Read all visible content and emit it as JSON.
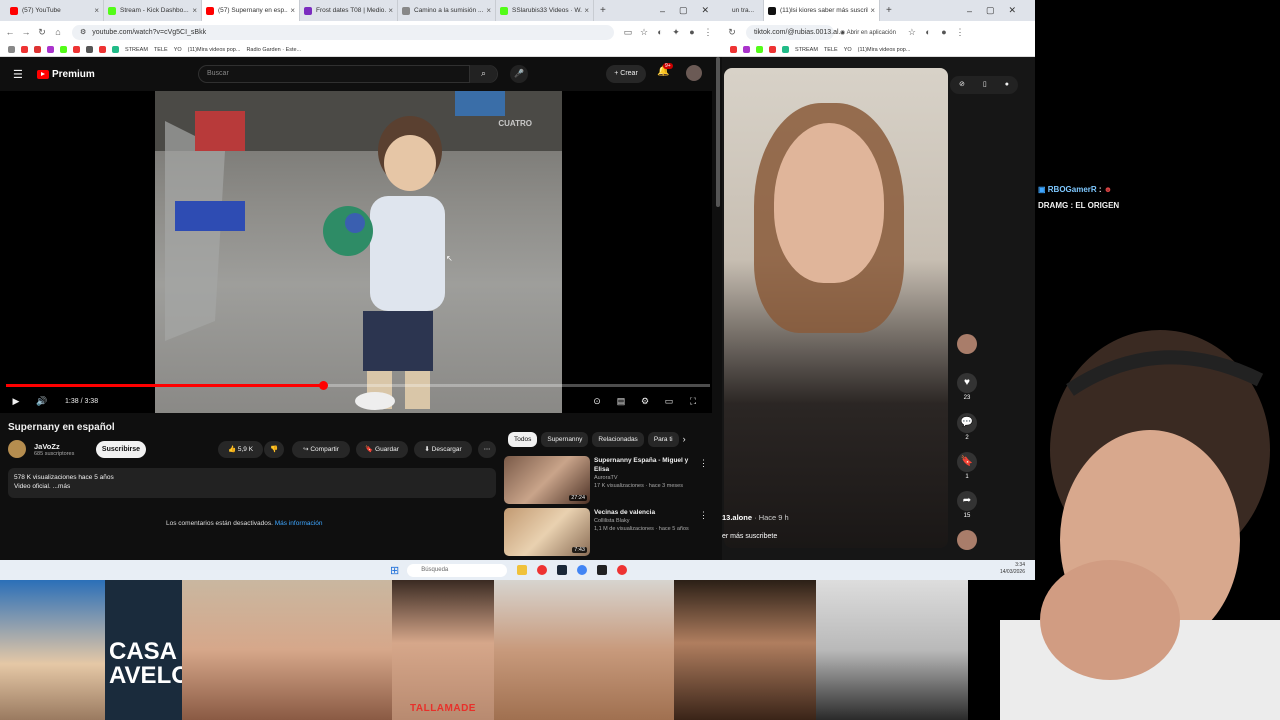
{
  "left_browser": {
    "tabs": [
      {
        "label": "(57) YouTube",
        "color": "#ff0000",
        "active": false
      },
      {
        "label": "Stream - Kick Dashbo...",
        "color": "#53fc18",
        "active": false
      },
      {
        "label": "(57) Supernany en esp...",
        "color": "#ff0000",
        "active": true
      },
      {
        "label": "Frost dates T08 | Medio...",
        "color": "#7b2cbf",
        "active": false
      },
      {
        "label": "Camino a la sumisión ...",
        "color": "#888888",
        "active": false
      },
      {
        "label": "SSlarubis33 Videos · W...",
        "color": "#53fc18",
        "active": false
      }
    ],
    "new_tab": "+",
    "url": "youtube.com/watch?v=cVg5CI_sBkk",
    "bookmarks": [
      "STREAM",
      "TELE",
      "YO",
      "(11)Mira videos pop...",
      "Radio Garden · Este..."
    ]
  },
  "youtube": {
    "logo": "Premium",
    "search_placeholder": "Buscar",
    "create_label": "Crear",
    "notif_badge": "9+",
    "video": {
      "watermark": "CUATRO",
      "time": "1:38 / 3:38",
      "progress": 0.45,
      "title": "Supernany en español",
      "channel": "JaVoZz",
      "subscribers": "685 suscriptores",
      "subscribe_label": "Suscribirse",
      "likes": "5,9 K",
      "share_label": "Compartir",
      "save_label": "Guardar",
      "download_label": "Descargar",
      "views_line": "578 K visualizaciones  hace 5 años",
      "desc_line": "Video oficial. ...más",
      "comments_off": "Los comentarios están desactivados.",
      "more_info": "Más información"
    },
    "chips": [
      "Todos",
      "Supernanny",
      "Relacionadas",
      "Para ti"
    ],
    "recommendations": [
      {
        "title": "Supernanny España - Miguel y Elisa",
        "channel": "AuroraTV",
        "stats": "17 K visualizaciones · hace 3 meses",
        "duration": "27:24"
      },
      {
        "title": "Vecinas de valencia",
        "channel": "Collilista Blaky",
        "stats": "1,1 M de visualizaciones · hace 5 años",
        "duration": "7:43"
      }
    ]
  },
  "right_browser": {
    "tabs": [
      {
        "label": "un tra...",
        "color": "#888888",
        "active": false
      },
      {
        "label": "(11)lsi kiores saber más suscribe",
        "color": "#111111",
        "active": true
      }
    ],
    "url": "tiktok.com/@rubias.0013.al...",
    "open_app": "Abrir en aplicación",
    "bookmarks": [
      "STREAM",
      "TELE",
      "YO",
      "(11)Mira videos pop..."
    ],
    "tiktok": {
      "user": "13.alone",
      "time_ago": "· Hace 9 h",
      "caption": "er más suscribete",
      "likes": "23",
      "comments": "2",
      "saves": "1",
      "shares": "15"
    }
  },
  "chat": [
    {
      "user": "RBOGamerR",
      "message": ""
    },
    {
      "user": "DRAMG",
      "message": "EL ORIGEN"
    }
  ],
  "taskbar": {
    "search_placeholder": "Búsqueda",
    "time": "3:34",
    "date": "14/03/2026"
  },
  "webcams": {
    "casa_text": "CASA D\nAVELO",
    "caption": "TALLAMADE"
  }
}
